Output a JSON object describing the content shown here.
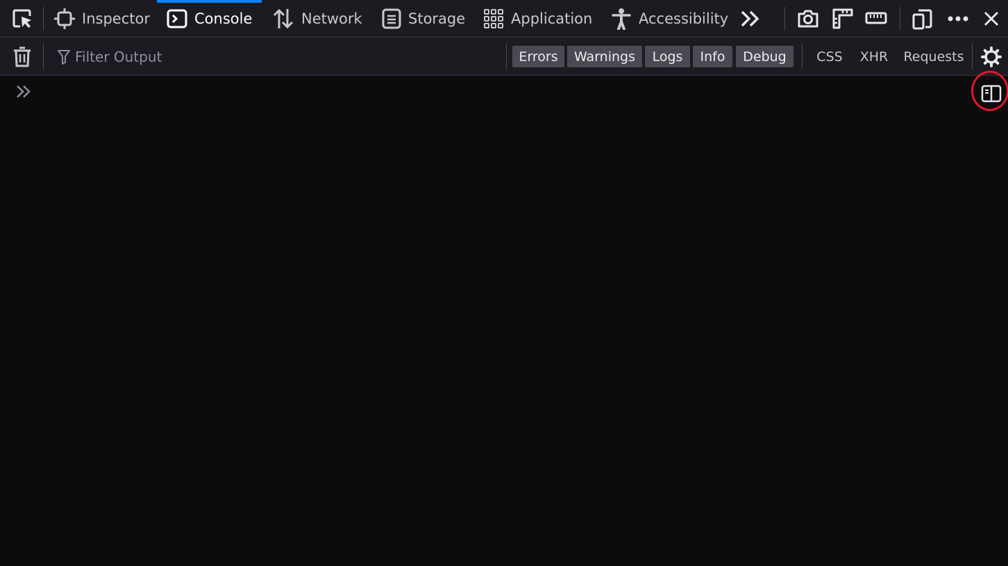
{
  "tabs": [
    {
      "id": "inspector",
      "label": "Inspector",
      "icon": "inspector-icon",
      "selected": false
    },
    {
      "id": "console",
      "label": "Console",
      "icon": "console-icon",
      "selected": true
    },
    {
      "id": "network",
      "label": "Network",
      "icon": "network-arrows-icon",
      "selected": false
    },
    {
      "id": "storage",
      "label": "Storage",
      "icon": "storage-icon",
      "selected": false
    },
    {
      "id": "application",
      "label": "Application",
      "icon": "grid-icon",
      "selected": false
    },
    {
      "id": "accessibility",
      "label": "Accessibility",
      "icon": "accessibility-icon",
      "selected": false
    }
  ],
  "toolbar": {
    "filter_placeholder": "Filter Output",
    "level_filters": [
      "Errors",
      "Warnings",
      "Logs",
      "Info",
      "Debug"
    ],
    "type_filters": [
      "CSS",
      "XHR",
      "Requests"
    ]
  },
  "colors": {
    "accent": "#0a84ff",
    "highlight": "#e3162b",
    "background": "#0c0c0d",
    "toolbar": "#1c1b22"
  }
}
